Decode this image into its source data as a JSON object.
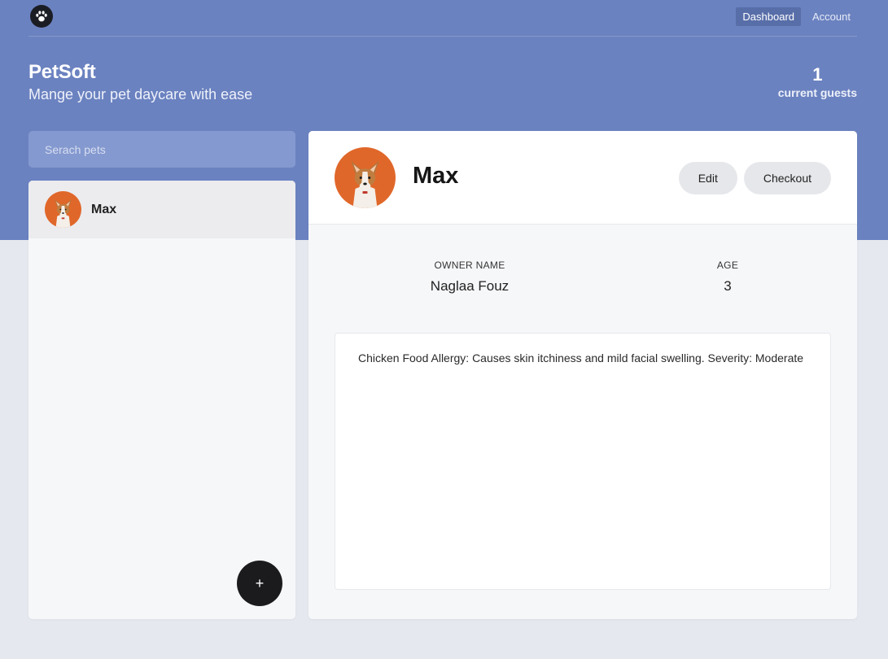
{
  "nav": {
    "logo_icon": "paw-icon",
    "links": [
      {
        "label": "Dashboard",
        "active": true
      },
      {
        "label": "Account",
        "active": false
      }
    ]
  },
  "brand": {
    "title": "PetSoft",
    "subtitle": "Mange your pet daycare with ease"
  },
  "stats": {
    "count": "1",
    "label": "current guests"
  },
  "search": {
    "placeholder": "Serach pets"
  },
  "pet_list": [
    {
      "name": "Max",
      "avatar_icon": "dog-photo-avatar"
    }
  ],
  "add_button": {
    "label": "+"
  },
  "selected_pet": {
    "name": "Max",
    "actions": {
      "edit": "Edit",
      "checkout": "Checkout"
    },
    "owner_label": "OWNER NAME",
    "owner_name": "Naglaa Fouz",
    "age_label": "AGE",
    "age": "3",
    "notes": "Chicken Food Allergy: Causes skin itchiness and mild facial swelling. Severity: Moderate"
  },
  "colors": {
    "header_bg": "#6b82c0",
    "page_bg": "#e5e8ee",
    "avatar_bg": "#e0672a"
  }
}
